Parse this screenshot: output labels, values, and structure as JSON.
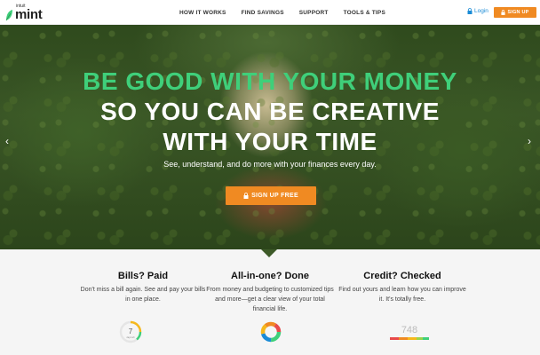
{
  "header": {
    "logo": {
      "brand_small": "intuit",
      "brand": "mint"
    },
    "nav": [
      "HOW IT WORKS",
      "FIND SAVINGS",
      "SUPPORT",
      "TOOLS & TIPS"
    ],
    "login_label": "Login",
    "signup_label": "SIGN UP"
  },
  "hero": {
    "headline_1": "BE GOOD WITH YOUR MONEY",
    "headline_2": "SO YOU CAN BE CREATIVE",
    "headline_3": "WITH YOUR TIME",
    "subheadline": "See, understand, and do more with your finances every day.",
    "cta_label": "SIGN UP FREE",
    "arrow_left": "‹",
    "arrow_right": "›"
  },
  "features": [
    {
      "title": "Bills? Paid",
      "desc": "Don't miss a bill again. See and pay your bills in one place.",
      "icon": "bill-gauge-icon",
      "icon_value": "7",
      "icon_caption": "days left"
    },
    {
      "title": "All-in-one? Done",
      "desc": "From money and budgeting to customized tips and more—get a clear view of your total financial life.",
      "icon": "budget-donut-icon"
    },
    {
      "title": "Credit? Checked",
      "desc": "Find out yours and learn how you can improve it. It's totally free.",
      "icon": "credit-score-icon",
      "icon_value": "748"
    }
  ],
  "colors": {
    "brand_green": "#3fcf7a",
    "cta_orange": "#f08a22",
    "link_blue": "#1a8bd6"
  }
}
